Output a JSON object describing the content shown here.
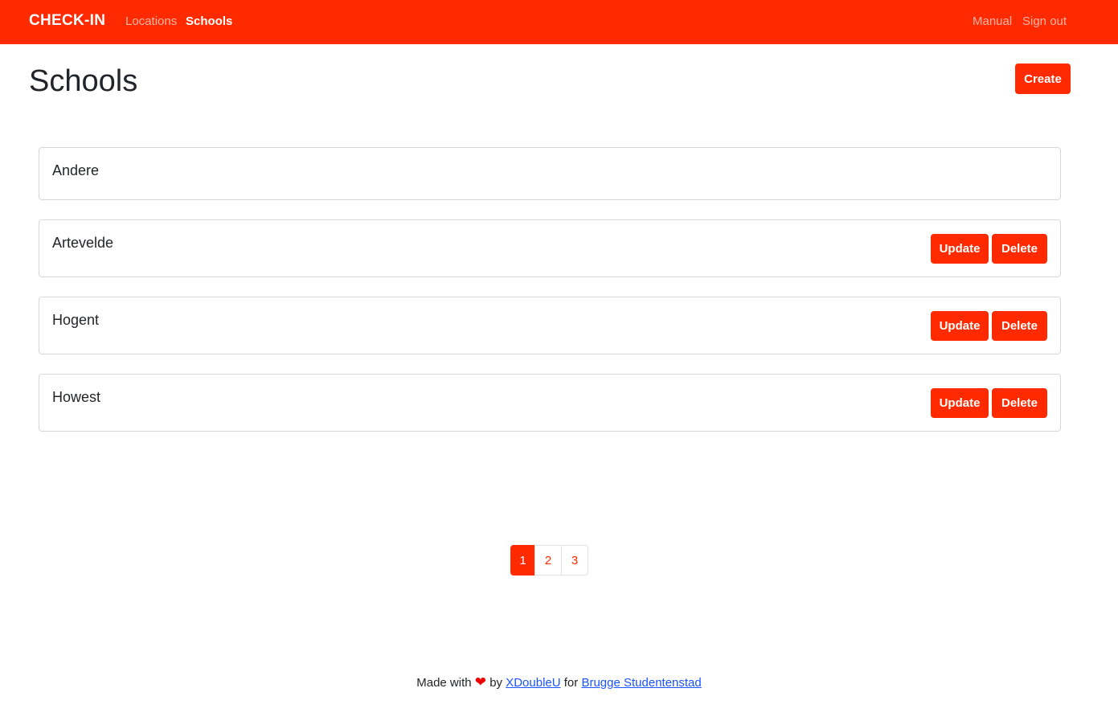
{
  "nav": {
    "brand": "CHECK-IN",
    "links": [
      "Locations",
      "Schools"
    ],
    "right_links": [
      "Manual",
      "Sign out"
    ],
    "active": "Schools"
  },
  "page": {
    "title": "Schools",
    "create_label": "Create"
  },
  "schools": [
    {
      "name": "Andere"
    },
    {
      "name": "Artevelde",
      "update_label": "Update",
      "delete_label": "Delete"
    },
    {
      "name": "Hogent",
      "update_label": "Update",
      "delete_label": "Delete"
    },
    {
      "name": "Howest",
      "update_label": "Update",
      "delete_label": "Delete"
    }
  ],
  "pagination": {
    "pages": [
      "1",
      "2",
      "3"
    ],
    "current": "1"
  },
  "footer": {
    "made_with": "Made with",
    "heart_icon": "heart-icon",
    "by": "by",
    "author": "XDoubleU",
    "for": "for",
    "client": "Brugge Studentenstad"
  },
  "colors": {
    "brand": "#ff2a00",
    "link": "#1a53ff"
  }
}
